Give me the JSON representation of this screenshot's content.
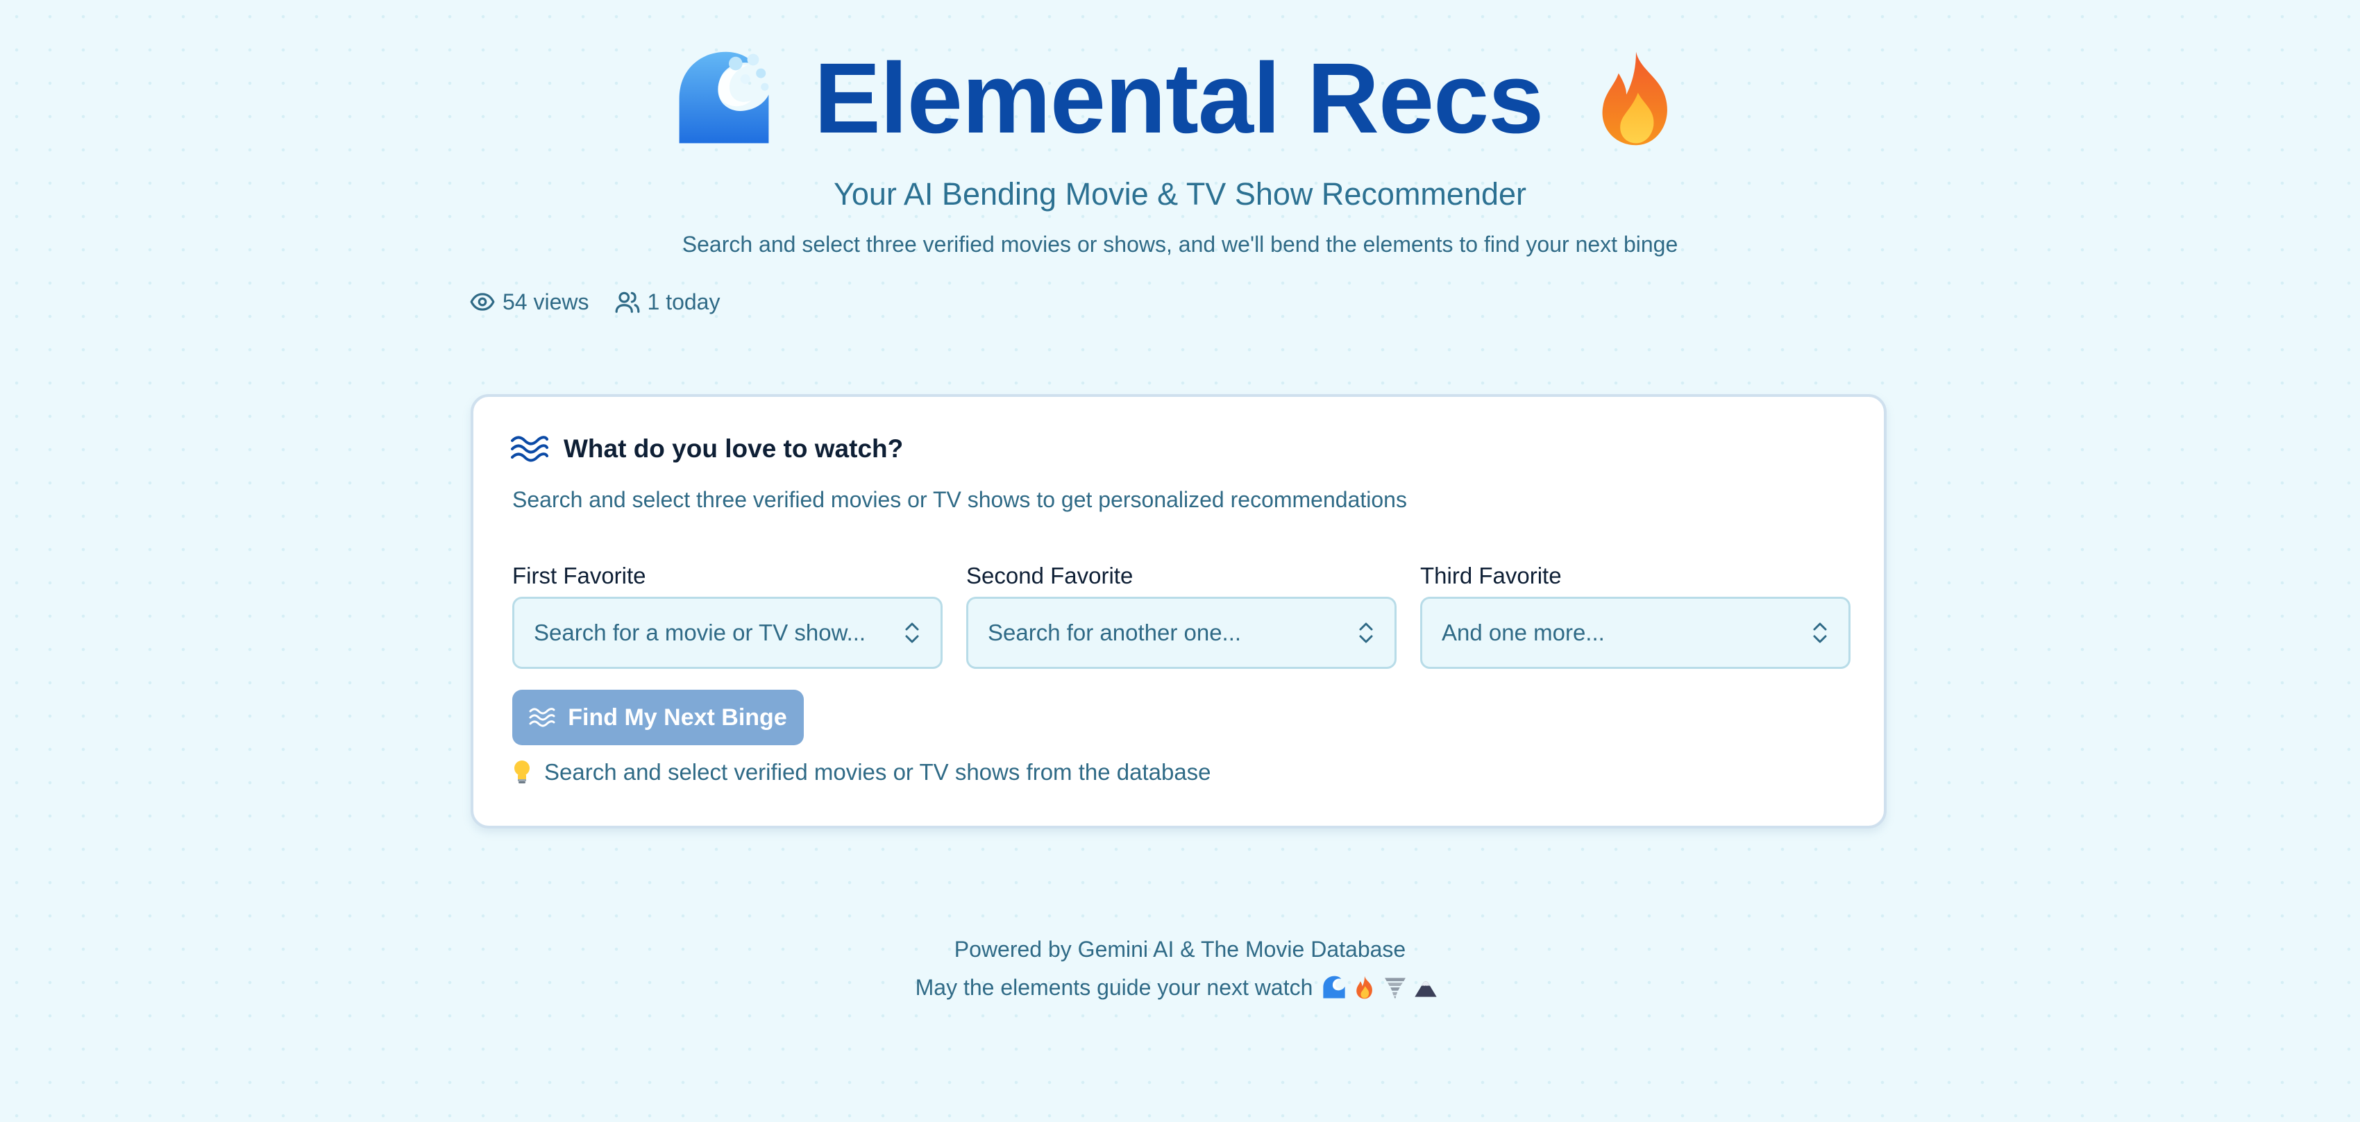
{
  "header": {
    "title": "Elemental Recs",
    "subtitle": "Your AI Bending Movie & TV Show Recommender",
    "tagline": "Search and select three verified movies or shows, and we'll bend the elements to find your next binge",
    "left_icon": "water-wave-icon",
    "right_icon": "fire-icon"
  },
  "stats": {
    "views": "54 views",
    "today": "1 today"
  },
  "card": {
    "title": "What do you love to watch?",
    "description": "Search and select three verified movies or TV shows to get personalized recommendations",
    "fields": [
      {
        "label": "First Favorite",
        "placeholder": "Search for a movie or TV show..."
      },
      {
        "label": "Second Favorite",
        "placeholder": "Search for another one..."
      },
      {
        "label": "Third Favorite",
        "placeholder": "And one more..."
      }
    ],
    "button_label": "Find My Next Binge",
    "hint": "Search and select verified movies or TV shows from the database"
  },
  "footer": {
    "powered_by": "Powered by Gemini AI & The Movie Database",
    "motto": "May the elements guide your next watch",
    "element_icons": [
      "water-wave-icon",
      "fire-icon",
      "tornado-icon",
      "mountain-icon"
    ]
  },
  "colors": {
    "background": "#ecf9fd",
    "title": "#0b4aa6",
    "text": "#2f6a86",
    "button": "#7fa9d6",
    "card_border": "#cfe0ee"
  }
}
